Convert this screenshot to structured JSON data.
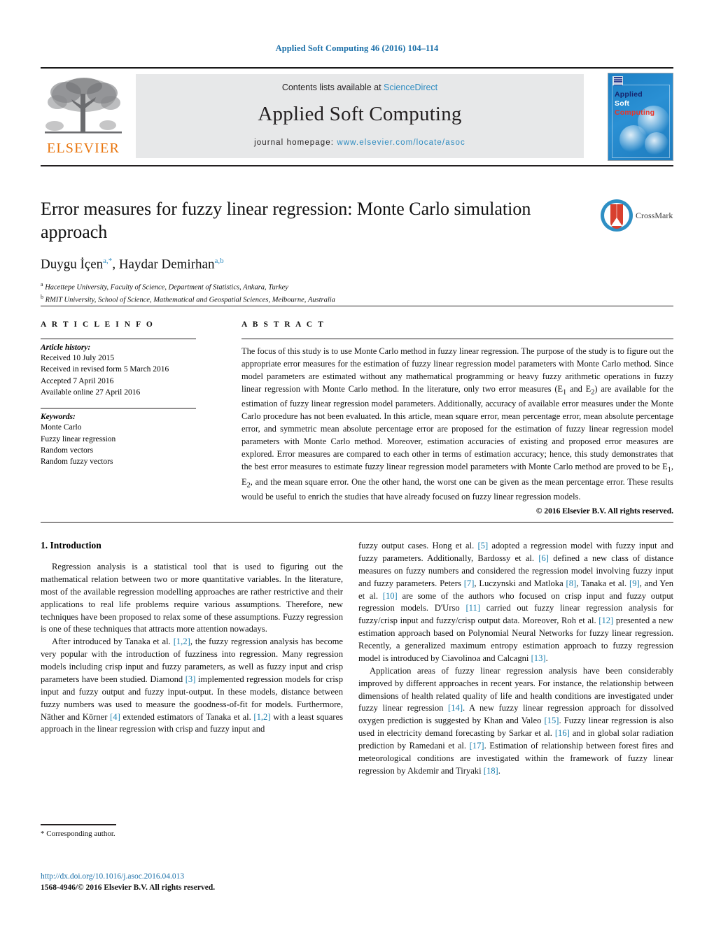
{
  "running_head": "Applied Soft Computing 46 (2016) 104–114",
  "masthead": {
    "publisher_name": "ELSEVIER",
    "contents_prefix": "Contents lists available at ",
    "contents_link": "ScienceDirect",
    "journal_title": "Applied Soft Computing",
    "homepage_prefix": "journal homepage: ",
    "homepage_url": "www.elsevier.com/locate/asoc",
    "cover": {
      "line1": "Applied",
      "line2": "Soft",
      "line3": "Computing"
    }
  },
  "article": {
    "title": "Error measures for fuzzy linear regression: Monte Carlo simulation approach",
    "authors_html": "Duygu İçen<sup>a,*</sup>, Haydar Demirhan<sup>a,b</sup>",
    "authors_plain": "Duygu İçen a,*, Haydar Demirhan a,b",
    "affiliations": [
      {
        "marker": "a",
        "text": "Hacettepe University, Faculty of Science, Department of Statistics, Ankara, Turkey"
      },
      {
        "marker": "b",
        "text": "RMIT University, School of Science, Mathematical and Geospatial Sciences, Melbourne, Australia"
      }
    ],
    "crossmark_label": "CrossMark"
  },
  "info": {
    "heading": "A R T I C L E   I N F O",
    "history_label": "Article history:",
    "history": [
      "Received 10 July 2015",
      "Received in revised form 5 March 2016",
      "Accepted 7 April 2016",
      "Available online 27 April 2016"
    ],
    "keywords_label": "Keywords:",
    "keywords": [
      "Monte Carlo",
      "Fuzzy linear regression",
      "Random vectors",
      "Random fuzzy vectors"
    ]
  },
  "abstract": {
    "heading": "A B S T R A C T",
    "text": "The focus of this study is to use Monte Carlo method in fuzzy linear regression. The purpose of the study is to figure out the appropriate error measures for the estimation of fuzzy linear regression model parameters with Monte Carlo method. Since model parameters are estimated without any mathematical programming or heavy fuzzy arithmetic operations in fuzzy linear regression with Monte Carlo method. In the literature, only two error measures (E1 and E2) are available for the estimation of fuzzy linear regression model parameters. Additionally, accuracy of available error measures under the Monte Carlo procedure has not been evaluated. In this article, mean square error, mean percentage error, mean absolute percentage error, and symmetric mean absolute percentage error are proposed for the estimation of fuzzy linear regression model parameters with Monte Carlo method. Moreover, estimation accuracies of existing and proposed error measures are explored. Error measures are compared to each other in terms of estimation accuracy; hence, this study demonstrates that the best error measures to estimate fuzzy linear regression model parameters with Monte Carlo method are proved to be E1, E2, and the mean square error. One the other hand, the worst one can be given as the mean percentage error. These results would be useful to enrich the studies that have already focused on fuzzy linear regression models.",
    "copyright": "© 2016 Elsevier B.V. All rights reserved."
  },
  "body": {
    "section_number_title": "1.  Introduction",
    "left_paragraphs": [
      "Regression analysis is a statistical tool that is used to figuring out the mathematical relation between two or more quantitative variables. In the literature, most of the available regression modelling approaches are rather restrictive and their applications to real life problems require various assumptions. Therefore, new techniques have been proposed to relax some of these assumptions. Fuzzy regression is one of these techniques that attracts more attention nowadays.",
      "After introduced by Tanaka et al. [1,2], the fuzzy regression analysis has become very popular with the introduction of fuzziness into regression. Many regression models including crisp input and fuzzy parameters, as well as fuzzy input and crisp parameters have been studied. Diamond [3] implemented regression models for crisp input and fuzzy output and fuzzy input-output. In these models, distance between fuzzy numbers was used to measure the goodness-of-fit for models. Furthermore, Näther and Körner [4] extended estimators of Tanaka et al. [1,2] with a least squares approach in the linear regression with crisp and fuzzy input and"
    ],
    "right_paragraphs": [
      "fuzzy output cases. Hong et al. [5] adopted a regression model with fuzzy input and fuzzy parameters. Additionally, Bardossy et al. [6] defined a new class of distance measures on fuzzy numbers and considered the regression model involving fuzzy input and fuzzy parameters. Peters [7], Luczynski and Matloka [8], Tanaka et al. [9], and Yen et al. [10] are some of the authors who focused on crisp input and fuzzy output regression models. D'Urso [11] carried out fuzzy linear regression analysis for fuzzy/crisp input and fuzzy/crisp output data. Moreover, Roh et al. [12] presented a new estimation approach based on Polynomial Neural Networks for fuzzy linear regression. Recently, a generalized maximum entropy estimation approach to fuzzy regression model is introduced by Ciavolinoa and Calcagni [13].",
      "Application areas of fuzzy linear regression analysis have been considerably improved by different approaches in recent years. For instance, the relationship between dimensions of health related quality of life and health conditions are investigated under fuzzy linear regression [14]. A new fuzzy linear regression approach for dissolved oxygen prediction is suggested by Khan and Valeo [15]. Fuzzy linear regression is also used in electricity demand forecasting by Sarkar et al. [16] and in global solar radiation prediction by Ramedani et al. [17]. Estimation of relationship between forest fires and meteorological conditions are investigated within the framework of fuzzy linear regression by Akdemir and Tiryaki [18]."
    ]
  },
  "footer": {
    "corresponding_note": "Corresponding author.",
    "corresponding_star": "*",
    "doi": "http://dx.doi.org/10.1016/j.asoc.2016.04.013",
    "issn_line": "1568-4946/© 2016 Elsevier B.V. All rights reserved."
  },
  "colors": {
    "link_blue": "#2d8bc0",
    "citation_blue": "#1a7fae",
    "header_blue": "#1a6fa8",
    "elsevier_orange": "#e8730a",
    "masthead_grey": "#e7e8e9"
  }
}
